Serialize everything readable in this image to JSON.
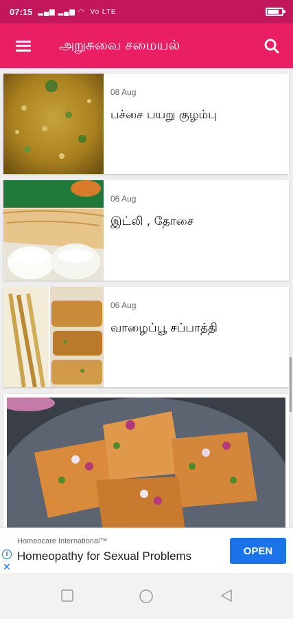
{
  "status_bar": {
    "time": "07:15",
    "signal_text": "Vo LTE"
  },
  "app_bar": {
    "title": "அறுசுவை சமையல்",
    "menu_icon": "hamburger-menu-icon",
    "search_icon": "search-icon"
  },
  "recipes": [
    {
      "date": "08 Aug",
      "title": "பச்சை பயறு குழம்பு"
    },
    {
      "date": "06 Aug",
      "title": "இட்லி , தோசை"
    },
    {
      "date": "06 Aug",
      "title": "வாழைப்பூ சப்பாத்தி"
    }
  ],
  "ad": {
    "advertiser": "Homeocare International™",
    "headline": "Homeopathy for Sexual Problems",
    "cta": "OPEN",
    "accent": "#1a73e8"
  },
  "colors": {
    "status_bar": "#c2185b",
    "app_bar": "#e91e63"
  }
}
